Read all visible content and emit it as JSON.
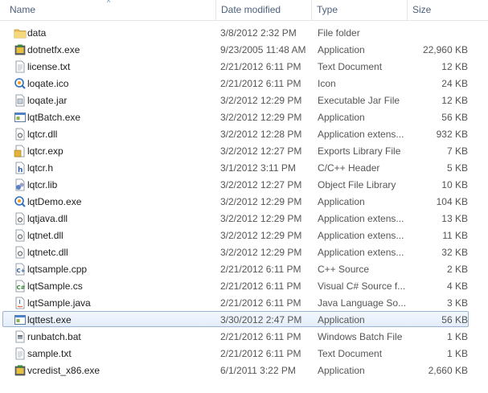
{
  "columns": {
    "name": "Name",
    "date": "Date modified",
    "type": "Type",
    "size": "Size"
  },
  "files": [
    {
      "name": "data",
      "date": "3/8/2012 2:32 PM",
      "type": "File folder",
      "size": "",
      "icon": "folder-icon"
    },
    {
      "name": "dotnetfx.exe",
      "date": "9/23/2005 11:48 AM",
      "type": "Application",
      "size": "22,960 KB",
      "icon": "installer-icon"
    },
    {
      "name": "license.txt",
      "date": "2/21/2012 6:11 PM",
      "type": "Text Document",
      "size": "12 KB",
      "icon": "text-file-icon"
    },
    {
      "name": "loqate.ico",
      "date": "2/21/2012 6:11 PM",
      "type": "Icon",
      "size": "24 KB",
      "icon": "loqate-icon"
    },
    {
      "name": "loqate.jar",
      "date": "3/2/2012 12:29 PM",
      "type": "Executable Jar File",
      "size": "12 KB",
      "icon": "jar-file-icon"
    },
    {
      "name": "lqtBatch.exe",
      "date": "3/2/2012 12:29 PM",
      "type": "Application",
      "size": "56 KB",
      "icon": "application-icon"
    },
    {
      "name": "lqtcr.dll",
      "date": "3/2/2012 12:28 PM",
      "type": "Application extens...",
      "size": "932 KB",
      "icon": "dll-file-icon"
    },
    {
      "name": "lqtcr.exp",
      "date": "3/2/2012 12:27 PM",
      "type": "Exports Library File",
      "size": "7 KB",
      "icon": "exp-file-icon"
    },
    {
      "name": "lqtcr.h",
      "date": "3/1/2012 3:11 PM",
      "type": "C/C++ Header",
      "size": "5 KB",
      "icon": "header-file-icon"
    },
    {
      "name": "lqtcr.lib",
      "date": "3/2/2012 12:27 PM",
      "type": "Object File Library",
      "size": "10 KB",
      "icon": "lib-file-icon"
    },
    {
      "name": "lqtDemo.exe",
      "date": "3/2/2012 12:29 PM",
      "type": "Application",
      "size": "104 KB",
      "icon": "loqate-icon"
    },
    {
      "name": "lqtjava.dll",
      "date": "3/2/2012 12:29 PM",
      "type": "Application extens...",
      "size": "13 KB",
      "icon": "dll-file-icon"
    },
    {
      "name": "lqtnet.dll",
      "date": "3/2/2012 12:29 PM",
      "type": "Application extens...",
      "size": "11 KB",
      "icon": "dll-file-icon"
    },
    {
      "name": "lqtnetc.dll",
      "date": "3/2/2012 12:29 PM",
      "type": "Application extens...",
      "size": "32 KB",
      "icon": "dll-file-icon"
    },
    {
      "name": "lqtsample.cpp",
      "date": "2/21/2012 6:11 PM",
      "type": "C++ Source",
      "size": "2 KB",
      "icon": "cpp-file-icon"
    },
    {
      "name": "lqtSample.cs",
      "date": "2/21/2012 6:11 PM",
      "type": "Visual C# Source f...",
      "size": "4 KB",
      "icon": "cs-file-icon"
    },
    {
      "name": "lqtSample.java",
      "date": "2/21/2012 6:11 PM",
      "type": "Java Language So...",
      "size": "3 KB",
      "icon": "java-file-icon"
    },
    {
      "name": "lqttest.exe",
      "date": "3/30/2012 2:47 PM",
      "type": "Application",
      "size": "56 KB",
      "icon": "application-icon",
      "selected": true
    },
    {
      "name": "runbatch.bat",
      "date": "2/21/2012 6:11 PM",
      "type": "Windows Batch File",
      "size": "1 KB",
      "icon": "batch-file-icon"
    },
    {
      "name": "sample.txt",
      "date": "2/21/2012 6:11 PM",
      "type": "Text Document",
      "size": "1 KB",
      "icon": "text-file-icon"
    },
    {
      "name": "vcredist_x86.exe",
      "date": "6/1/2011 3:22 PM",
      "type": "Application",
      "size": "2,660 KB",
      "icon": "installer-icon"
    }
  ]
}
